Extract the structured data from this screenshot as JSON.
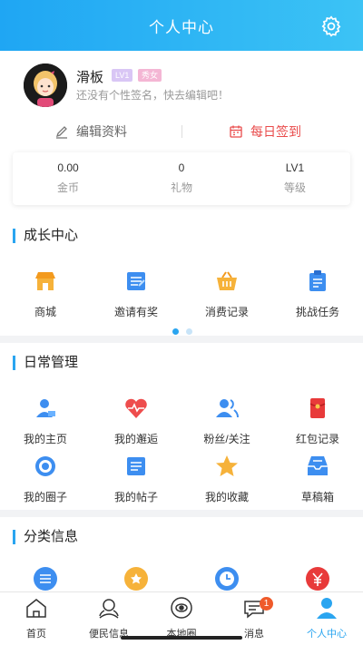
{
  "header": {
    "title": "个人中心"
  },
  "profile": {
    "username": "滑板",
    "level_badge": "LV1",
    "gender_badge": "秀女",
    "signature": "还没有个性签名，快去编辑吧！",
    "edit_label": "编辑资料",
    "checkin_label": "每日签到"
  },
  "stats": [
    {
      "value": "0.00",
      "label": "金币"
    },
    {
      "value": "0",
      "label": "礼物"
    },
    {
      "value": "LV1",
      "label": "等级"
    }
  ],
  "growth": {
    "title": "成长中心",
    "items": [
      {
        "label": "商城",
        "icon": "shop-icon"
      },
      {
        "label": "邀请有奖",
        "icon": "invite-icon"
      },
      {
        "label": "消费记录",
        "icon": "basket-icon"
      },
      {
        "label": "挑战任务",
        "icon": "clipboard-icon"
      }
    ]
  },
  "daily": {
    "title": "日常管理",
    "items": [
      {
        "label": "我的主页",
        "icon": "user-card-icon"
      },
      {
        "label": "我的邂逅",
        "icon": "heartbeat-icon"
      },
      {
        "label": "粉丝/关注",
        "icon": "followers-icon"
      },
      {
        "label": "红包记录",
        "icon": "red-envelope-icon"
      },
      {
        "label": "我的圈子",
        "icon": "target-icon"
      },
      {
        "label": "我的帖子",
        "icon": "post-icon"
      },
      {
        "label": "我的收藏",
        "icon": "star-icon"
      },
      {
        "label": "草稿箱",
        "icon": "inbox-icon"
      }
    ]
  },
  "category": {
    "title": "分类信息"
  },
  "tabbar": [
    {
      "label": "首页",
      "icon": "home-icon"
    },
    {
      "label": "便民信息",
      "icon": "service-icon"
    },
    {
      "label": "本地圈",
      "icon": "local-circle-icon"
    },
    {
      "label": "消息",
      "icon": "message-icon",
      "badge": "1"
    },
    {
      "label": "个人中心",
      "icon": "profile-icon",
      "active": true
    }
  ],
  "colors": {
    "accent": "#2aa5f0",
    "checkin": "#e94b4b",
    "header_start": "#1fa6f3",
    "header_end": "#3cc3f5"
  }
}
